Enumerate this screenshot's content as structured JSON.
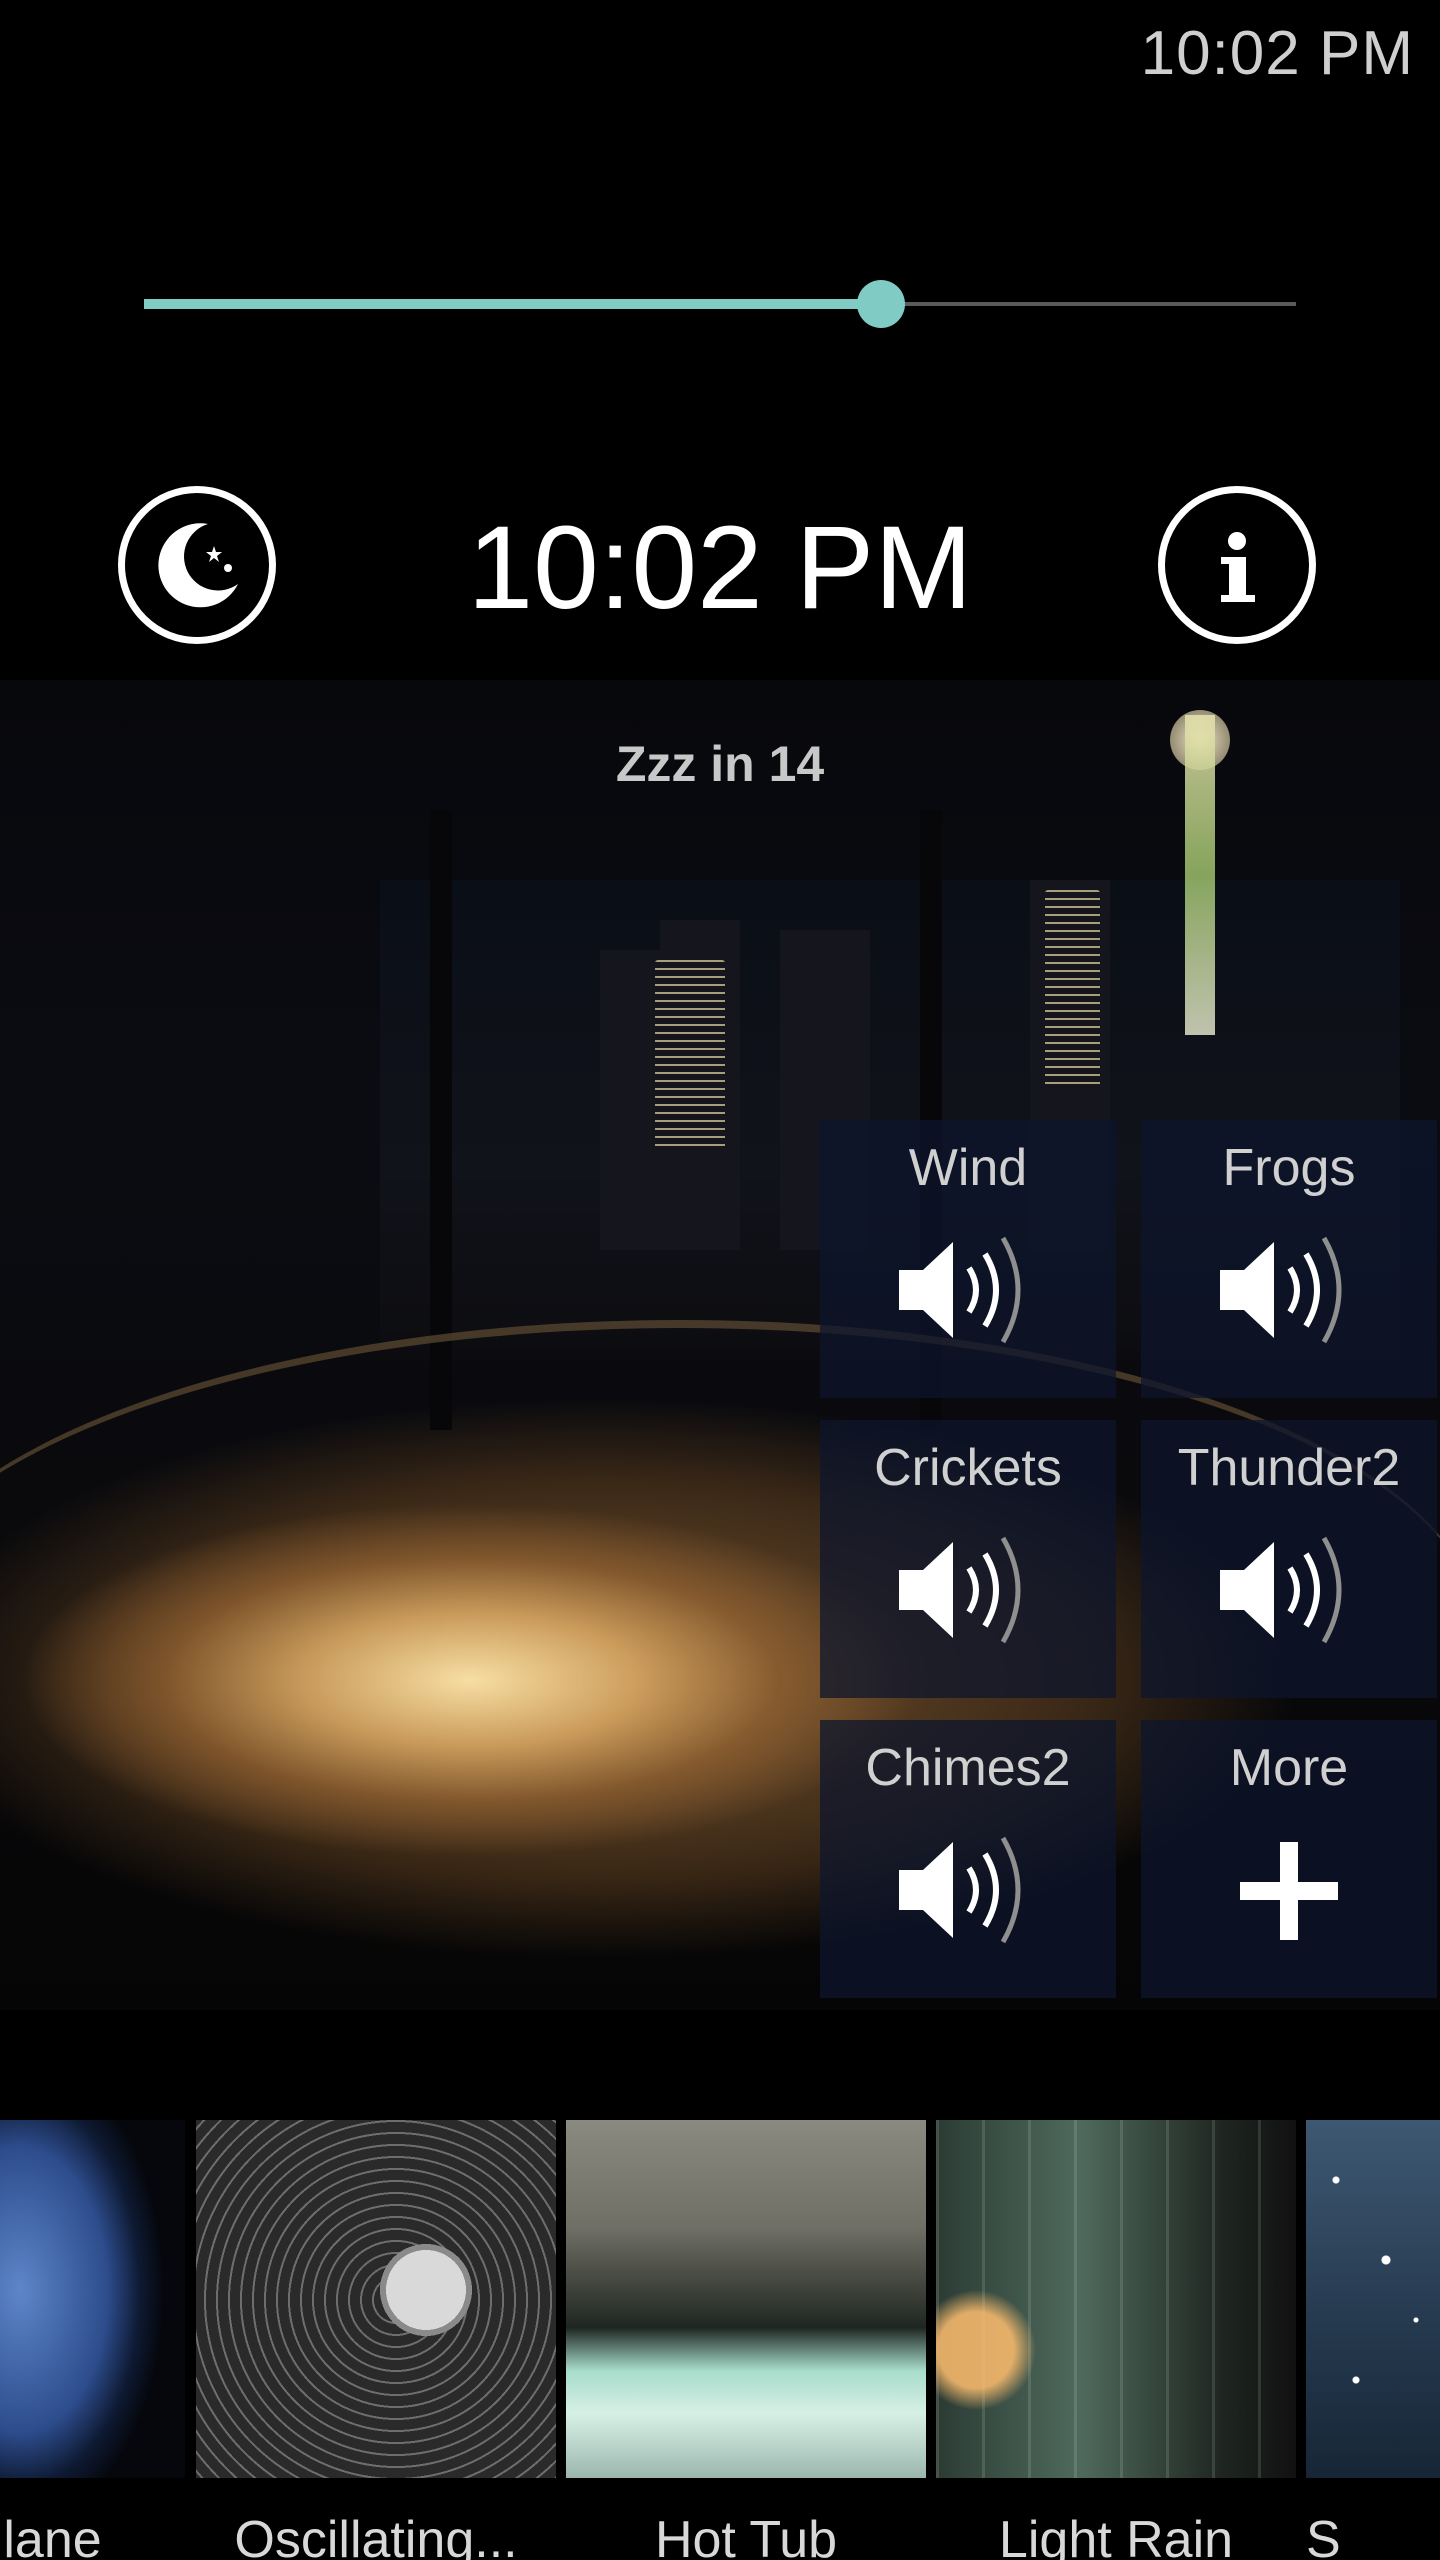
{
  "status_bar": {
    "time": "10:02 PM"
  },
  "volume_slider": {
    "value_fraction": 0.64,
    "accent_color": "#80cbc4"
  },
  "clock": {
    "time": "10:02 PM",
    "countdown": "Zzz in 14",
    "left_icon": "moon-stars-icon",
    "right_icon": "info-icon"
  },
  "sounds": {
    "tiles": [
      {
        "label": "Wind",
        "icon": "speaker-icon"
      },
      {
        "label": "Frogs",
        "icon": "speaker-icon"
      },
      {
        "label": "Crickets",
        "icon": "speaker-icon"
      },
      {
        "label": "Thunder2",
        "icon": "speaker-icon"
      },
      {
        "label": "Chimes2",
        "icon": "speaker-icon"
      },
      {
        "label": "More",
        "icon": "plus-icon"
      }
    ]
  },
  "scenes": {
    "items": [
      {
        "label": "lane"
      },
      {
        "label": "Oscillating..."
      },
      {
        "label": "Hot Tub"
      },
      {
        "label": "Light Rain"
      },
      {
        "label": "S"
      }
    ]
  }
}
